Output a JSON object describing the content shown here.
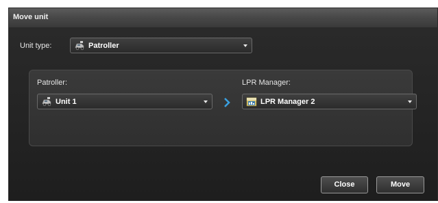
{
  "dialog": {
    "title": "Move unit"
  },
  "unit_type": {
    "label": "Unit type:",
    "selected": "Patroller",
    "icon": "patroller-vehicle-icon"
  },
  "source": {
    "label": "Patroller:",
    "selected": "Unit 1",
    "icon": "patroller-vehicle-icon"
  },
  "arrow_icon": "chevron-right-icon",
  "destination": {
    "label": "LPR Manager:",
    "selected": "LPR Manager 2",
    "icon": "lpr-manager-icon"
  },
  "buttons": {
    "close": "Close",
    "move": "Move"
  },
  "colors": {
    "accent": "#3aa0e0",
    "background": "#1c1c1c"
  }
}
